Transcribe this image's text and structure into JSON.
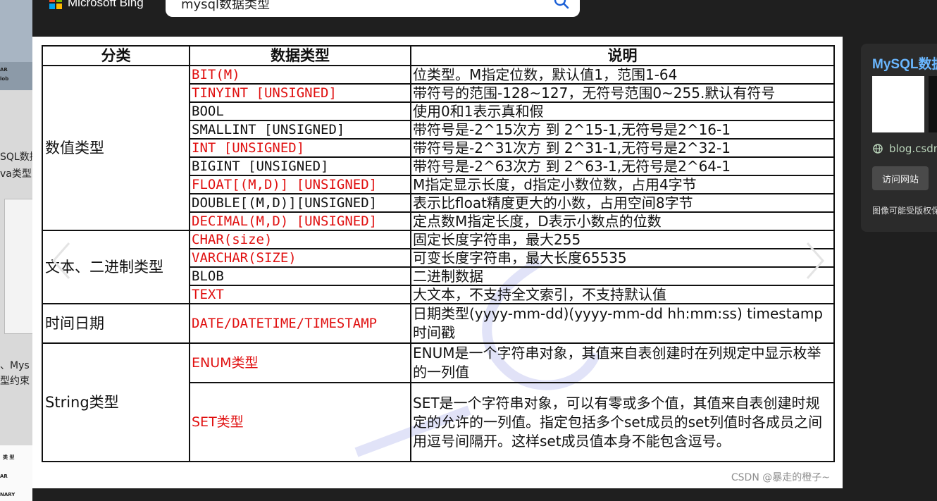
{
  "header": {
    "brand": "Microsoft Bing",
    "search_query": "mysql数据类型",
    "logo_colors": [
      "#f25022",
      "#7fba00",
      "#00a4ef",
      "#ffb900"
    ]
  },
  "table": {
    "headers": [
      "分类",
      "数据类型",
      "说明"
    ],
    "rows": [
      {
        "category": "数值类型",
        "type": "BIT(M)",
        "red": true,
        "desc": "位类型。M指定位数，默认值1，范围1-64"
      },
      {
        "type": "TINYINT [UNSIGNED]",
        "red": true,
        "desc": "带符号的范围-128~127，无符号范围0~255.默认有符号"
      },
      {
        "type": "BOOL",
        "red": false,
        "desc": "使用0和1表示真和假"
      },
      {
        "type": "SMALLINT [UNSIGNED]",
        "red": false,
        "desc": "带符号是-2^15次方  到  2^15-1,无符号是2^16-1"
      },
      {
        "type": "INT [UNSIGNED]",
        "red": true,
        "desc": "带符号是-2^31次方  到  2^31-1,无符号是2^32-1"
      },
      {
        "type": "BIGINT [UNSIGNED]",
        "red": false,
        "desc": "带符号是-2^63次方  到  2^63-1,无符号是2^64-1"
      },
      {
        "type": "FLOAT[(M,D)] [UNSIGNED]",
        "red": true,
        "desc": "M指定显示长度，d指定小数位数，占用4字节"
      },
      {
        "type": "DOUBLE[(M,D)][UNSIGNED]",
        "red": false,
        "desc": "表示比float精度更大的小数，占用空间8字节"
      },
      {
        "type": "DECIMAL(M,D) [UNSIGNED]",
        "red": true,
        "desc": "定点数M指定长度，D表示小数点的位数"
      },
      {
        "category": "文本、二进制类型",
        "type": "CHAR(size)",
        "red": true,
        "desc": "固定长度字符串，最大255"
      },
      {
        "type": "VARCHAR(SIZE)",
        "red": true,
        "desc": "可变长度字符串，最大长度65535"
      },
      {
        "type": "BLOB",
        "red": false,
        "desc": "二进制数据"
      },
      {
        "type": "TEXT",
        "red": true,
        "desc": "大文本，不支持全文索引，不支持默认值"
      },
      {
        "category": "时间日期",
        "type": "DATE/DATETIME/TIMESTAMP",
        "red": true,
        "desc": "日期类型(yyyy-mm-dd)(yyyy-mm-dd hh:mm:ss) timestamp时间戳"
      },
      {
        "category": "String类型",
        "type": "ENUM类型",
        "red": true,
        "desc": "ENUM是一个字符串对象，其值来自表创建时在列规定中显示枚举的一列值"
      },
      {
        "type": "SET类型",
        "red": true,
        "desc": "SET是一个字符串对象，可以有零或多个值，其值来自表创建时规定的允许的一列值。指定包括多个set成员的set列值时各成员之间用逗号间隔开。这样set成员值本身不能包含逗号。"
      }
    ],
    "watermark_text": "CSDN @暴走的橙子~"
  },
  "side_panel": {
    "title": "MySQL数据类型",
    "site": "blog.csdn.net",
    "visit_button": "访问网站",
    "note": "图像可能受版权保护"
  },
  "left_strip": {
    "lines": [
      "SQL数据",
      "va类型",
      "、Mys",
      "型约束",
      "AR",
      "lob",
      "类 型",
      "AR",
      "NARY"
    ]
  }
}
